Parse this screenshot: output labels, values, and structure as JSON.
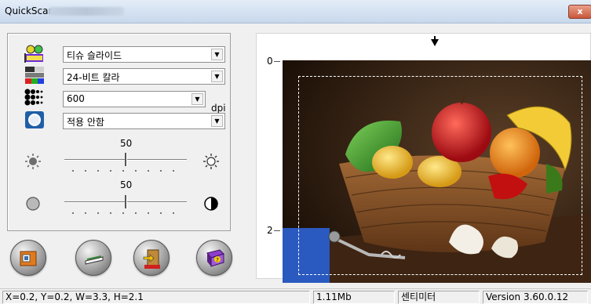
{
  "window": {
    "title": "QuickScan",
    "close_label": "x"
  },
  "settings": {
    "source": {
      "icon": "transparency-slide-icon",
      "value": "티슈 슬라이드"
    },
    "color_mode": {
      "icon": "color-mode-icon",
      "value": "24-비트 칼라"
    },
    "resolution": {
      "icon": "resolution-dots-icon",
      "value": "600",
      "unit": "dpi"
    },
    "filter": {
      "icon": "filter-lens-icon",
      "value": "적용 안함"
    },
    "brightness": {
      "value": "50",
      "level": 0.5
    },
    "contrast": {
      "value": "50",
      "level": 0.5
    }
  },
  "buttons": [
    {
      "name": "scan-button",
      "icon": "scan-to-folder-icon"
    },
    {
      "name": "preview-button",
      "icon": "scanner-icon"
    },
    {
      "name": "exit-button",
      "icon": "exit-door-icon"
    },
    {
      "name": "help-button",
      "icon": "help-book-icon"
    }
  ],
  "preview": {
    "ruler_labels": [
      "0",
      "2"
    ]
  },
  "status": {
    "selection": "X=0.2, Y=0.2, W=3.3, H=2.1",
    "size": "1.11Mb",
    "unit": "센티미터",
    "version": "Version 3.60.0.12"
  }
}
